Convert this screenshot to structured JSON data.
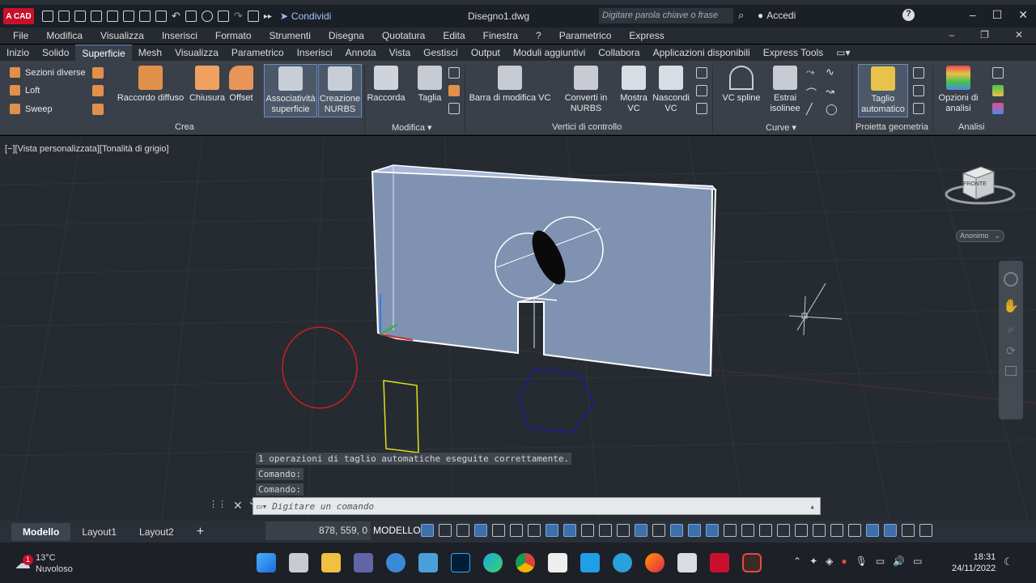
{
  "app": {
    "logo_text": "A CAD",
    "share_label": "Condividi",
    "document_title": "Disegno1.dwg",
    "search_placeholder": "Digitare parola chiave o frase",
    "signin_label": "Accedi"
  },
  "menubar": {
    "items": [
      "File",
      "Modifica",
      "Visualizza",
      "Inserisci",
      "Formato",
      "Strumenti",
      "Disegna",
      "Quotatura",
      "Edita",
      "Finestra",
      "?",
      "Parametrico",
      "Express"
    ]
  },
  "ribbon_tabs": {
    "items": [
      "Inizio",
      "Solido",
      "Superficie",
      "Mesh",
      "Visualizza",
      "Parametrico",
      "Inserisci",
      "Annota",
      "Vista",
      "Gestisci",
      "Output",
      "Moduli aggiuntivi",
      "Collabora",
      "Applicazioni disponibili",
      "Express Tools"
    ],
    "active": "Superficie"
  },
  "ribbon": {
    "crea": {
      "small": [
        "Sezioni diverse",
        "Loft",
        "Sweep"
      ],
      "raccordo_diffuso": "Raccordo diffuso",
      "chiusura": "Chiusura",
      "offset": "Offset",
      "associativita_1": "Associatività",
      "associativita_2": "superficie",
      "creazione_1": "Creazione",
      "creazione_2": "NURBS",
      "label": "Crea"
    },
    "modifica": {
      "raccorda": "Raccorda",
      "taglia": "Taglia",
      "label": "Modifica"
    },
    "vertici": {
      "barra": "Barra di modifica VC",
      "converti_1": "Converti in",
      "converti_2": "NURBS",
      "mostra_1": "Mostra",
      "mostra_2": "VC",
      "nascondi_1": "Nascondi",
      "nascondi_2": "VC",
      "label": "Vertici di controllo"
    },
    "curve": {
      "vc_spline": "VC spline",
      "estrai_1": "Estrai",
      "estrai_2": "isolinee",
      "label": "Curve"
    },
    "proietta": {
      "taglio_1": "Taglio",
      "taglio_2": "automatico",
      "label": "Proietta geometria"
    },
    "analisi": {
      "opzioni_1": "Opzioni di",
      "opzioni_2": "analisi",
      "label": "Analisi"
    }
  },
  "viewport": {
    "label": "[−][Vista personalizzata][Tonalità di grigio]",
    "viewcube_face": "FRONTE",
    "ucs_name": "Anonimo",
    "history": [
      "1 operazioni di taglio automatiche eseguite correttamente.",
      "Comando:",
      "Comando:"
    ]
  },
  "command_line": {
    "placeholder": "Digitare un comando"
  },
  "statusbar": {
    "tabs": [
      "Modello",
      "Layout1",
      "Layout2"
    ],
    "active_tab": "Modello",
    "add_label": "+",
    "coordinates": "878, 559, 0",
    "mode": "MODELLO"
  },
  "taskbar": {
    "temperature": "13°C",
    "weather": "Nuvoloso",
    "weather_badge": "1",
    "time": "18:31",
    "date": "24/11/2022"
  },
  "colors": {
    "accent": "#3e6fa8",
    "viewport_bg": "#262b31",
    "ribbon_bg": "#3a404a",
    "circle": "#cc2020",
    "rectangle": "#e0e020",
    "hexagon": "#1a1a9a",
    "solid_fill": "#8fa4c8"
  }
}
